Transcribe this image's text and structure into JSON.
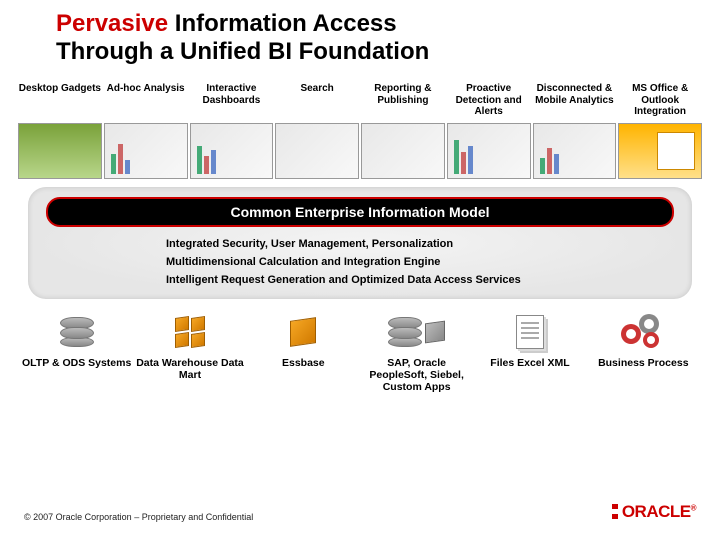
{
  "title": {
    "highlight": "Pervasive",
    "rest1": " Information Access",
    "line2": "Through a Unified BI Foundation"
  },
  "top_cells": [
    "Desktop Gadgets",
    "Ad-hoc Analysis",
    "Interactive Dashboards",
    "Search",
    "Reporting & Publishing",
    "Proactive Detection and Alerts",
    "Disconnected & Mobile Analytics",
    "MS Office & Outlook Integration"
  ],
  "model_bar": "Common Enterprise Information Model",
  "services": [
    "Integrated Security,  User Management, Personalization",
    "Multidimensional Calculation and Integration Engine",
    "Intelligent Request Generation and Optimized Data Access Services"
  ],
  "sources": [
    "OLTP & ODS Systems",
    "Data Warehouse Data Mart",
    "Essbase",
    "SAP, Oracle PeopleSoft, Siebel, Custom Apps",
    "Files Excel XML",
    "Business Process"
  ],
  "copyright": "© 2007 Oracle Corporation – Proprietary and Confidential",
  "logo": {
    "main": "ORACLE",
    "reg": "®"
  }
}
